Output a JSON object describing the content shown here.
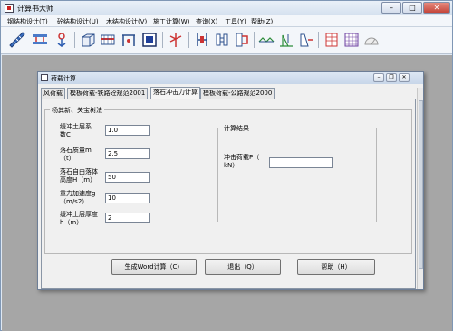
{
  "app": {
    "title": "计算书大师",
    "buttons": {
      "minimize": "–",
      "maximize": "□",
      "close": "✕"
    }
  },
  "menu": {
    "items": [
      "钢结构设计(T)",
      "砼结构设计(U)",
      "木结构设计(V)",
      "施工计算(W)",
      "查询(X)",
      "工具(Y)",
      "帮助(Z)"
    ]
  },
  "toolbar": {
    "icons": [
      "ruler-icon",
      "beam-icon",
      "bolt-icon",
      "box-icon",
      "slab-icon",
      "frame-icon",
      "section-icon",
      "column-icon",
      "wood-icon",
      "steel-section-icon",
      "pipe-icon",
      "truss-icon",
      "wall-icon",
      "retaining-wall-icon",
      "table-icon",
      "grid-icon",
      "measure-icon"
    ]
  },
  "dialog": {
    "title": "荷载计算",
    "buttons": {
      "minimize": "–",
      "restore": "❐",
      "close": "✕"
    },
    "tabs": [
      "风荷载",
      "模板荷载-铁路砼规范2001",
      "落石冲击力计算",
      "模板荷载-公路规范2000"
    ],
    "active_tab": 2,
    "group_input": {
      "label": "杨其新、关宝树法",
      "fields": [
        {
          "label": "缓冲土层系\n数C",
          "value": "1.0"
        },
        {
          "label": "落石质量m\n（t）",
          "value": "2.5"
        },
        {
          "label": "落石自由落体\n高度H（m）",
          "value": "50"
        },
        {
          "label": "重力加速度g\n（m/s2）",
          "value": "10"
        },
        {
          "label": "缓冲土层厚度\nh（m）",
          "value": "2"
        }
      ]
    },
    "group_result": {
      "label": "计算结果",
      "fields": [
        {
          "label": "冲击荷载P（\nkN）",
          "value": ""
        }
      ]
    },
    "actions": {
      "calc": "生成Word计算（C）",
      "exit": "退出（Q）",
      "help": "帮助（H）"
    }
  }
}
